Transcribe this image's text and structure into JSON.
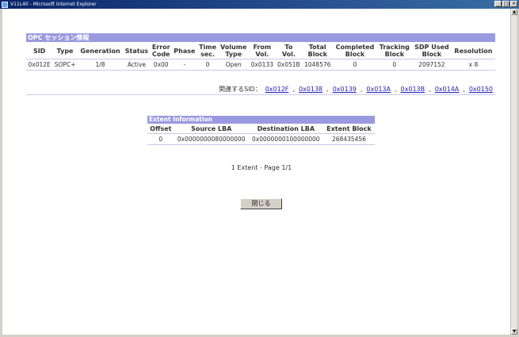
{
  "window": {
    "title": "V11L40 - Microsoft Internet Explorer",
    "buttons": [
      "_",
      "□",
      "×"
    ]
  },
  "session": {
    "section_title": "OPC セッション情報",
    "columns": [
      "SID",
      "Type",
      "Generation",
      "Status",
      "Error\nCode",
      "Phase",
      "Time\nsec.",
      "Volume\nType",
      "From\nVol.",
      "To\nVol.",
      "Total\nBlock",
      "Completed\nBlock",
      "Tracking\nBlock",
      "SDP Used\nBlock",
      "Resolution"
    ],
    "rows": [
      [
        "0x012E",
        "SOPC+",
        "1/8",
        "Active",
        "0x00",
        "-",
        "0",
        "Open",
        "0x0133",
        "0x051B",
        "1048576",
        "0",
        "0",
        "2097152",
        "x 8"
      ]
    ],
    "related_label": "関連するSID：",
    "related_sids": [
      "0x012F",
      "0x0138",
      "0x0139",
      "0x013A",
      "0x013B",
      "0x014A",
      "0x0150"
    ]
  },
  "extent": {
    "section_title": "Extent Information",
    "columns": [
      "Offset",
      "Source LBA",
      "Destination LBA",
      "Extent Block"
    ],
    "rows": [
      [
        "0",
        "0x0000000080000000",
        "0x0000000100000000",
        "268435456"
      ]
    ],
    "page_info": "1 Extent - Page 1/1"
  },
  "close_button": "閉じる"
}
